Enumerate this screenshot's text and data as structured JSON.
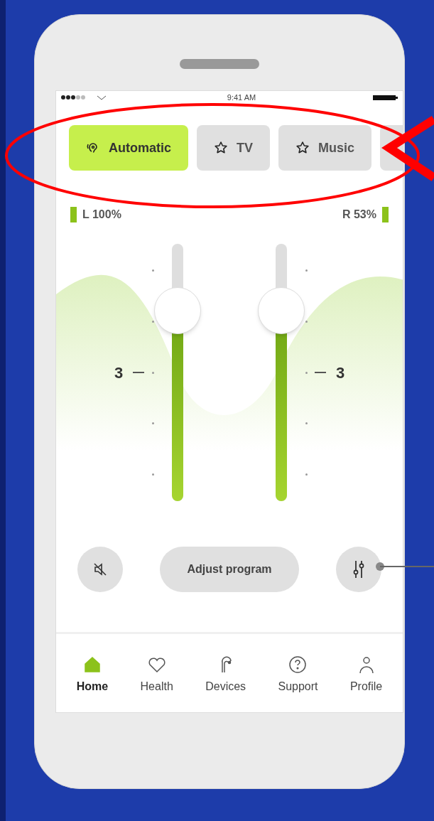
{
  "status_bar": {
    "time": "9:41 AM"
  },
  "programs": [
    {
      "label": "Automatic",
      "kind": "auto",
      "selected": true
    },
    {
      "label": "TV",
      "kind": "favorite",
      "selected": false
    },
    {
      "label": "Music",
      "kind": "favorite",
      "selected": false
    }
  ],
  "batteries": {
    "left": "L 100%",
    "right": "R 53%"
  },
  "volume": [
    {
      "kind": "left",
      "value": "3",
      "level": 0.74
    },
    {
      "kind": "right",
      "value": "3",
      "level": 0.74
    }
  ],
  "actions": {
    "adjust_label": "Adjust program"
  },
  "nav": [
    {
      "label": "Home",
      "kind": "home",
      "selected": true
    },
    {
      "label": "Health",
      "kind": "health",
      "selected": false
    },
    {
      "label": "Devices",
      "kind": "devices",
      "selected": false
    },
    {
      "label": "Support",
      "kind": "support",
      "selected": false
    },
    {
      "label": "Profile",
      "kind": "profile",
      "selected": false
    }
  ]
}
